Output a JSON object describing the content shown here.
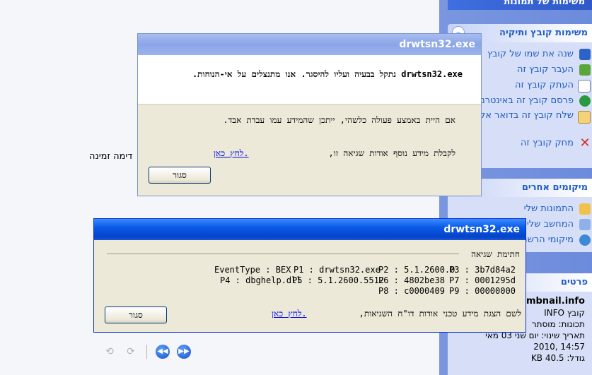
{
  "taskpane": {
    "header_label": "משימות של תמונות",
    "file_tasks": {
      "title": "משימות קובץ ותיקיה",
      "items": [
        {
          "label": "שנה את שמו של קובץ",
          "icon": "rename-icon"
        },
        {
          "label": "העבר קובץ זה",
          "icon": "move-icon"
        },
        {
          "label": "העתק קובץ זה",
          "icon": "copy-icon"
        },
        {
          "label": "פרסם קובץ זה באינטרנט",
          "icon": "publish-web-icon"
        },
        {
          "label": "שלח קובץ זה בדואר אלקטרוני",
          "icon": "email-icon"
        },
        {
          "label": "מחק קובץ זה",
          "icon": "delete-icon"
        }
      ]
    },
    "other_places": {
      "title": "מיקומים אחרים",
      "items": [
        {
          "label": "התמונות שלי",
          "icon": "my-pictures-icon"
        },
        {
          "label": "המחשב שלי",
          "icon": "my-computer-icon"
        },
        {
          "label": "מיקומי הרשת",
          "icon": "network-places-icon"
        }
      ]
    },
    "details": {
      "title": "פרטים",
      "filename": "thumbnail.info",
      "type": "קובץ INFO",
      "props": "תכונות: מוסתר",
      "modified_label": "תאריך שינוי: יום שני 03 מאי",
      "modified_time": "14:57 ,2010",
      "size": "גודל: 40.5 KB"
    }
  },
  "background": {
    "text": "דימה זמינה"
  },
  "dialog1": {
    "title": "drwtsn32.exe",
    "message": "drwtsn32.exe נתקל בבעיה ועליו להיסגר. אנו מתנצלים על אי-הנוחות.",
    "info_line": "אם היית באמצע פעולה כלשהי, ייתכן שהמידע עמו עבדת אבד.",
    "more_info_line": "לקבלת מידע נוסף אודות שגיאה זו,",
    "link": "לחץ כאן.",
    "close_label": "סגור"
  },
  "dialog2": {
    "title": "drwtsn32.exe",
    "group_label": "חתימת שגיאה",
    "signature": [
      [
        "EventType : BEX",
        "P1 : drwtsn32.exe",
        "P2 : 5.1.2600.0",
        "P3 : 3b7d84a2"
      ],
      [
        "P4 : dbghelp.dll",
        "P5 : 5.1.2600.5512",
        "P6 : 4802be38",
        "P7 : 0001295d"
      ],
      [
        "",
        "",
        "P8 : c0000409",
        "P9 : 00000000"
      ]
    ],
    "report_line": "לשם הצגת מידע טכני אודות דו\"ח השגיאות,",
    "link": "לחץ כאן.",
    "close_label": "סגור"
  },
  "nav": {
    "icons": [
      "rotate-ccw-icon",
      "rotate-cw-icon",
      "prev-icon",
      "next-icon"
    ]
  }
}
